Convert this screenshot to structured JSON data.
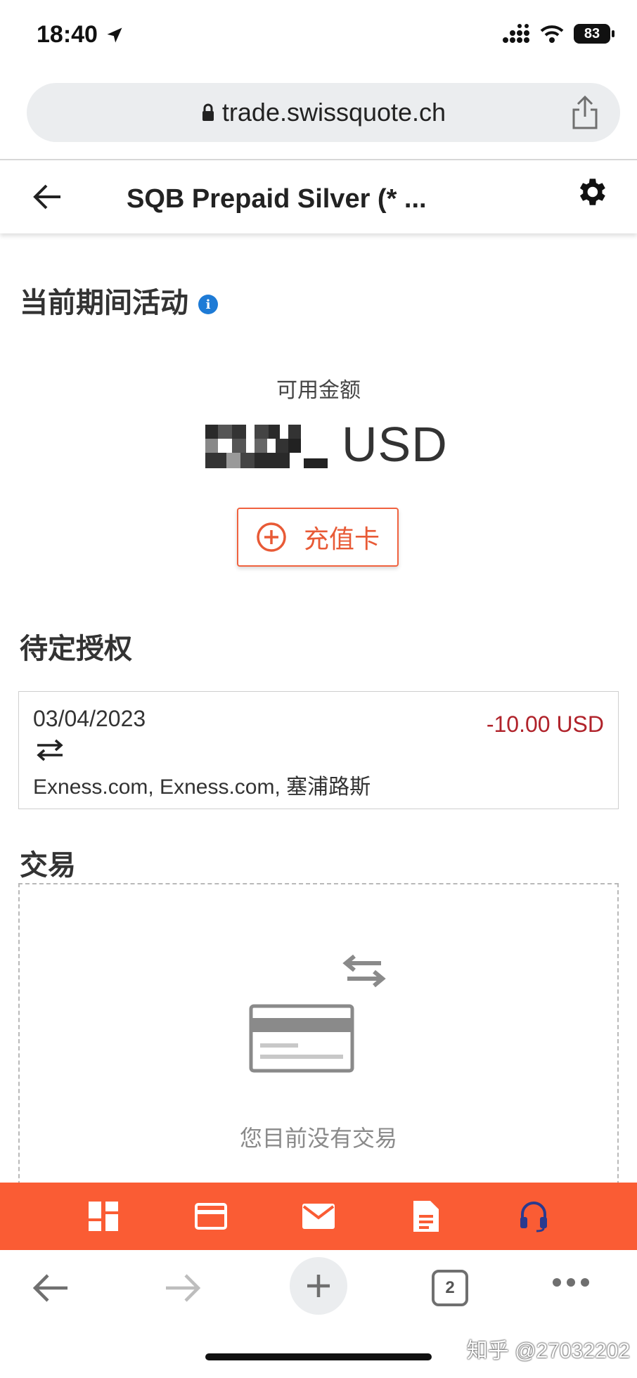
{
  "status_bar": {
    "time": "18:40",
    "battery": "83"
  },
  "browser": {
    "url": "trade.swissquote.ch",
    "tab_count": "2"
  },
  "header": {
    "title": "SQB Prepaid Silver (* ..."
  },
  "current_period": {
    "title": "当前期间活动",
    "info_glyph": "i",
    "available_label": "可用金额",
    "currency": "USD"
  },
  "topup": {
    "label": "充值卡"
  },
  "pending": {
    "title": "待定授权",
    "items": [
      {
        "date": "03/04/2023",
        "amount": "-10.00 USD",
        "merchant": "Exness.com, Exness.com, 塞浦路斯"
      }
    ]
  },
  "transactions": {
    "title": "交易",
    "empty_text": "您目前没有交易"
  },
  "app_nav": {
    "items": [
      {
        "name": "dashboard-icon"
      },
      {
        "name": "card-icon"
      },
      {
        "name": "mail-icon"
      },
      {
        "name": "document-icon"
      },
      {
        "name": "support-headset-icon"
      }
    ]
  },
  "watermark": "知乎 @27032202",
  "colors": {
    "accent": "#fa5c34",
    "negative": "#b0222a",
    "info": "#1e7bd6"
  }
}
